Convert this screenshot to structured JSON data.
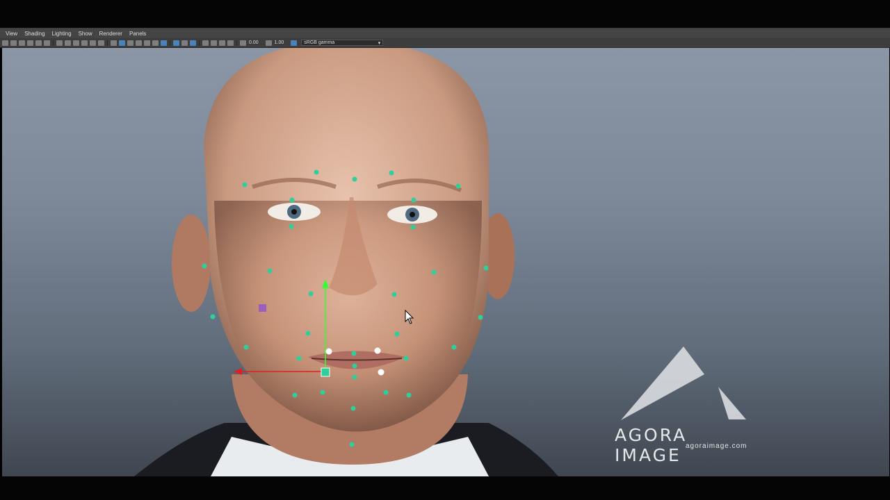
{
  "menu": {
    "items": [
      "View",
      "Shading",
      "Lighting",
      "Show",
      "Renderer",
      "Panels"
    ]
  },
  "toolbar": {
    "exposure_value": "0.00",
    "gamma_value": "1.00",
    "color_space": "sRGB gamma"
  },
  "icons": {
    "dropdown": "chevron-down-icon",
    "cursor": "mouse-pointer-icon"
  },
  "watermark": {
    "brand": "AGORA IMAGE",
    "url": "agoraimage.com"
  },
  "colors": {
    "control_point": "#2ecf9a",
    "selected_point": "#ffffff",
    "y_axis": "#33ff33",
    "x_axis": "#e02020",
    "handle": "#9b5fc0"
  }
}
